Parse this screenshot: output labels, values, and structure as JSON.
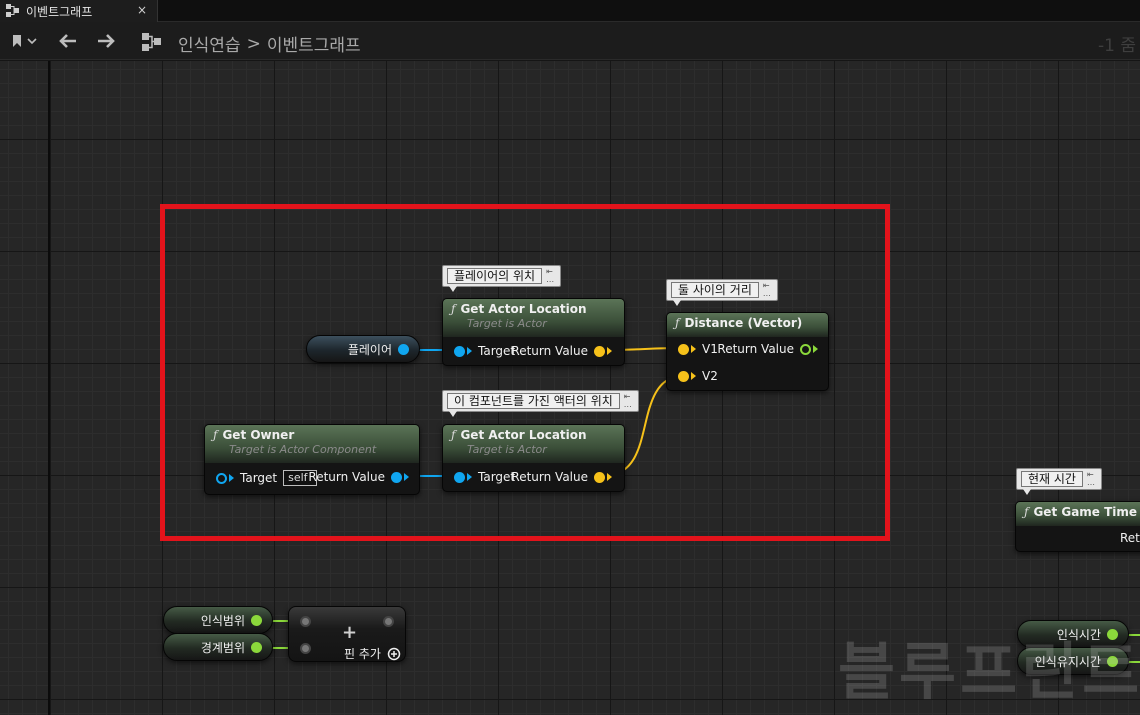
{
  "tab": {
    "title": "이벤트그래프",
    "close": "×"
  },
  "toolbar": {
    "breadcrumb": [
      "인식연습",
      "이벤트그래프"
    ],
    "separator": ">",
    "zoom": "-1 줌"
  },
  "comments": {
    "player_location": "플레이어의 위치",
    "distance": "둘 사이의 거리",
    "owner_location": "이 컴포넌트를 가진 액터의 위치",
    "current_time": "현재 시간"
  },
  "nodes": {
    "player_var": {
      "label": "플레이어"
    },
    "get_actor_location_1": {
      "title": "Get Actor Location",
      "subtitle": "Target is Actor",
      "target": "Target",
      "return": "Return Value"
    },
    "get_actor_location_2": {
      "title": "Get Actor Location",
      "subtitle": "Target is Actor",
      "target": "Target",
      "return": "Return Value"
    },
    "distance": {
      "title": "Distance (Vector)",
      "v1": "V1",
      "v2": "V2",
      "return": "Return Value"
    },
    "get_owner": {
      "title": "Get Owner",
      "subtitle": "Target is Actor Component",
      "target": "Target",
      "self_value": "self",
      "return": "Return Value"
    },
    "get_game_time": {
      "title": "Get Game Time in S",
      "return": "Retu"
    },
    "perception_range_var": {
      "label": "인식범위"
    },
    "alert_range_var": {
      "label": "경계범위"
    },
    "make_array": {
      "add_pin": "핀 추가",
      "plus": "+"
    },
    "perception_time_var": {
      "label": "인식시간"
    },
    "perception_hold_time_var": {
      "label": "인식유지시간"
    }
  },
  "watermark": "블루프린트",
  "colors": {
    "object_pin": "#10a6f0",
    "vector_pin": "#f6c11a",
    "float_pin": "#8bd83b",
    "highlight": "#e3131b",
    "function_header": "#5b7457"
  }
}
